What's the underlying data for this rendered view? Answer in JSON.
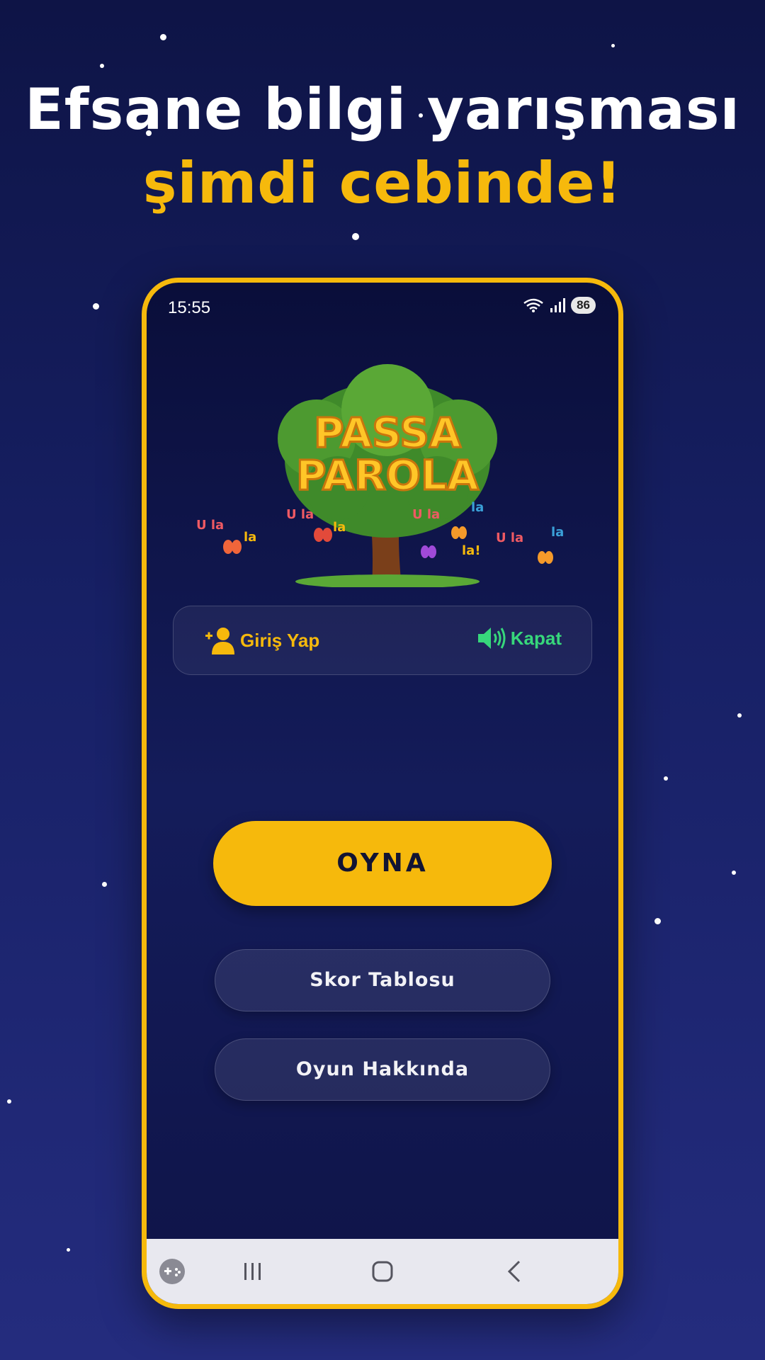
{
  "promo": {
    "headline_line1": "Efsane bilgi yarışması",
    "headline_line2": "şimdi cebinde!"
  },
  "colors": {
    "accent": "#f6b90c",
    "background_top": "#0e1446",
    "background_bottom": "#242c7e",
    "sound_green": "#37d77b"
  },
  "status_bar": {
    "time": "15:55",
    "battery": "86",
    "icons": [
      "wifi-icon",
      "signal-icon",
      "battery-icon"
    ]
  },
  "logo": {
    "title_line1": "PASSA",
    "title_line2": "PAROLA",
    "scattered_words": [
      "U la",
      "la",
      "U la",
      "la",
      "U la",
      "la",
      "la!",
      "U la",
      "la"
    ]
  },
  "top_bar": {
    "login_label": "Giriş Yap",
    "login_icon": "add-user-icon",
    "sound_label": "Kapat",
    "sound_icon": "speaker-icon"
  },
  "menu": {
    "play_label": "OYNA",
    "scoreboard_label": "Skor Tablosu",
    "about_label": "Oyun Hakkında"
  },
  "nav_bar": {
    "icons": [
      "game-launcher-icon",
      "recents-icon",
      "home-icon",
      "back-icon"
    ]
  }
}
